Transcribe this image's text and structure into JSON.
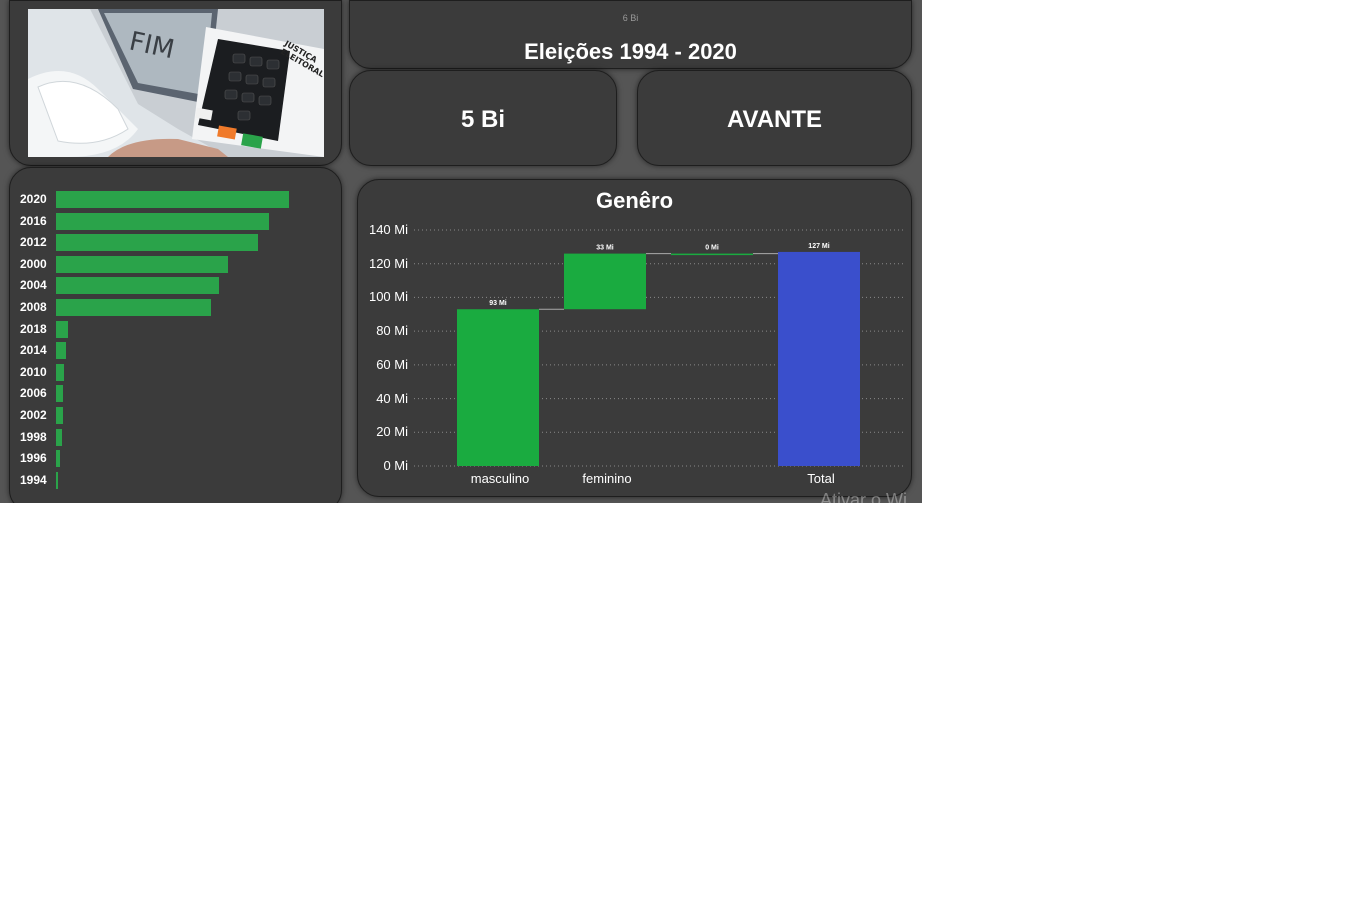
{
  "header": {
    "small_value": "6 Bi",
    "title": "Eleições 1994 - 2020"
  },
  "kpis": {
    "total_value": "5 Bi",
    "top_party": "AVANTE"
  },
  "photo": {
    "screen_text": "FIM",
    "brand_text_1": "JUSTIÇA",
    "brand_text_2": "ELEITORAL"
  },
  "years_chart": {
    "type": "bar",
    "categories": [
      "2020",
      "2016",
      "2012",
      "2000",
      "2004",
      "2008",
      "2018",
      "2014",
      "2010",
      "2006",
      "2002",
      "1998",
      "1996",
      "1994"
    ],
    "values": [
      1.0,
      0.915,
      0.865,
      0.74,
      0.7,
      0.665,
      0.05,
      0.042,
      0.036,
      0.032,
      0.03,
      0.026,
      0.018,
      0.01
    ],
    "color": "#2aa34a"
  },
  "chart_data": {
    "type": "bar",
    "subtype": "waterfall",
    "title": "Genêro",
    "categories": [
      "masculino",
      "feminino",
      "",
      "Total"
    ],
    "values": [
      93,
      33,
      0,
      127
    ],
    "data_labels": [
      "93 Mi",
      "33 Mi",
      "0 Mi",
      "127 Mi"
    ],
    "ylim": [
      0,
      140
    ],
    "yticks": [
      "0 Mi",
      "20 Mi",
      "40 Mi",
      "60 Mi",
      "80 Mi",
      "100 Mi",
      "120 Mi",
      "140 Mi"
    ],
    "grid": true,
    "colors": {
      "increase": "#1aab40",
      "total": "#3a4fcc"
    }
  },
  "watermark": "Ativar o Wi"
}
